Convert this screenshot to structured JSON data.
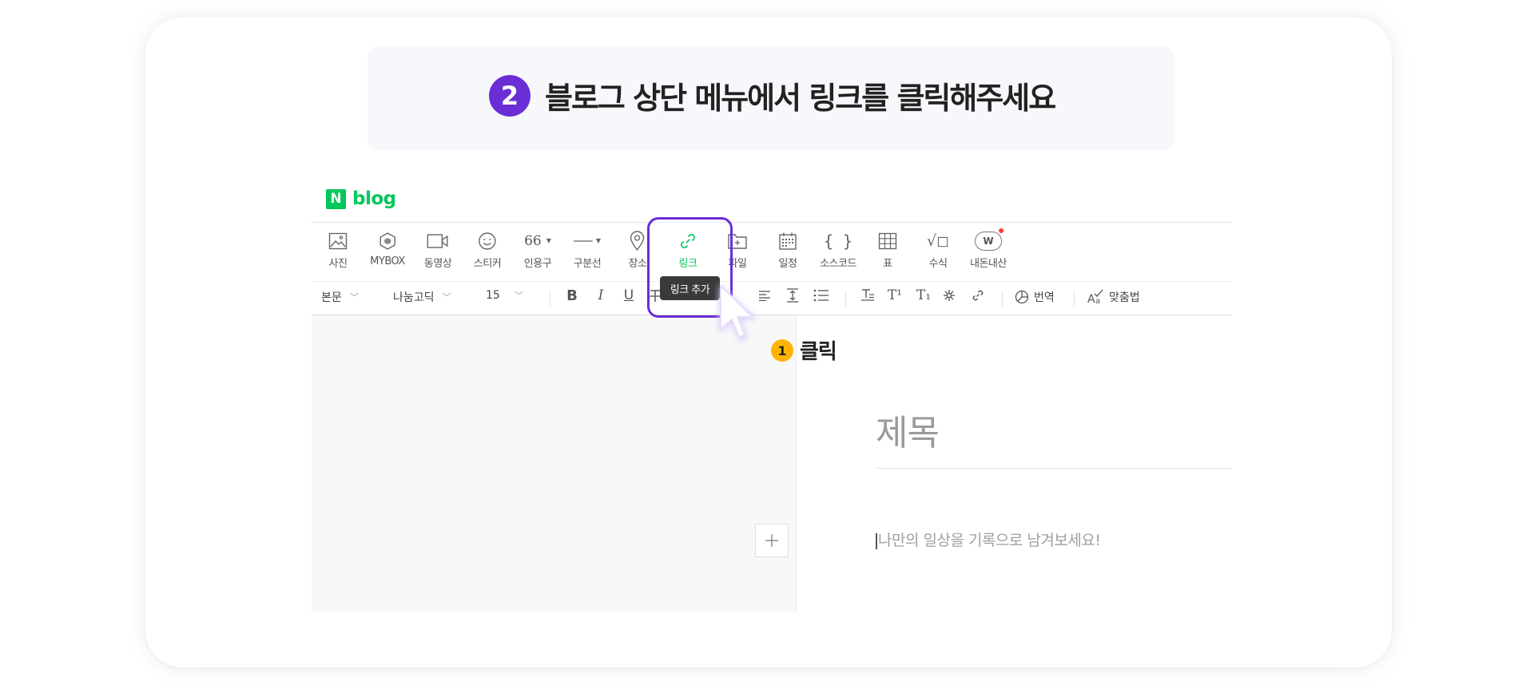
{
  "banner": {
    "step_number": "2",
    "title": "블로그 상단 메뉴에서 링크를 클릭해주세요"
  },
  "logo": {
    "n": "N",
    "text": "blog"
  },
  "toolbar": {
    "items": [
      {
        "label": "사진",
        "icon": "photo-icon"
      },
      {
        "label": "MYBOX",
        "icon": "mybox-icon"
      },
      {
        "label": "동영상",
        "icon": "video-icon"
      },
      {
        "label": "스티커",
        "icon": "sticker-icon"
      },
      {
        "label": "인용구",
        "icon": "quote-icon",
        "glyph": "66"
      },
      {
        "label": "구분선",
        "icon": "divider-icon"
      },
      {
        "label": "장소",
        "icon": "location-icon"
      },
      {
        "label": "링크",
        "icon": "link-icon"
      },
      {
        "label": "파일",
        "icon": "file-icon"
      },
      {
        "label": "일정",
        "icon": "calendar-icon"
      },
      {
        "label": "소스코드",
        "icon": "code-icon",
        "glyph": "{ }"
      },
      {
        "label": "표",
        "icon": "table-icon"
      },
      {
        "label": "수식",
        "icon": "formula-icon",
        "glyph": "√◻"
      },
      {
        "label": "내돈내산",
        "icon": "mydonnaesan-icon",
        "glyph": "W"
      }
    ],
    "active": "링크",
    "active_color": "#03c75a"
  },
  "format_bar": {
    "paragraph_style": "본문",
    "font": "나눔고딕",
    "size": "15",
    "bold": "B",
    "italic": "I",
    "underline": "U",
    "superscript": "T¹",
    "subscript": "T₁",
    "translate_label": "번역",
    "spellcheck_label": "맞춤법"
  },
  "tooltip": {
    "text": "링크 추가"
  },
  "callout": {
    "number": "1",
    "label": "클릭"
  },
  "document": {
    "title_placeholder": "제목",
    "body_placeholder": "나만의 일상을 기록으로 남겨보세요!"
  },
  "colors": {
    "brand": "#03c75a",
    "highlight": "#6b2ed6",
    "callout": "#ffb400"
  }
}
